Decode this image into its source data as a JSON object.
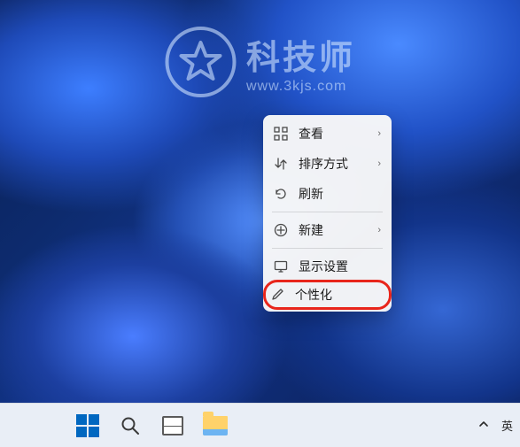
{
  "watermark": {
    "title": "科技师",
    "url": "www.3kjs.com"
  },
  "contextMenu": {
    "items": [
      {
        "label": "查看",
        "hasSubmenu": true
      },
      {
        "label": "排序方式",
        "hasSubmenu": true
      },
      {
        "label": "刷新",
        "hasSubmenu": false
      }
    ],
    "items2": [
      {
        "label": "新建",
        "hasSubmenu": true
      }
    ],
    "items3": [
      {
        "label": "显示设置",
        "hasSubmenu": false
      },
      {
        "label": "个性化",
        "hasSubmenu": false,
        "highlighted": true
      }
    ]
  },
  "taskbar": {
    "ime": "英"
  }
}
